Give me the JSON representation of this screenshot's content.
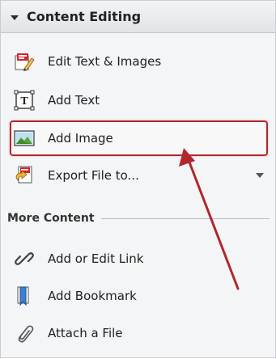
{
  "header": {
    "title": "Content Editing"
  },
  "content_editing": {
    "items": [
      {
        "label": "Edit Text & Images",
        "icon": "edit-text-images-icon"
      },
      {
        "label": "Add Text",
        "icon": "add-text-icon"
      },
      {
        "label": "Add Image",
        "icon": "add-image-icon"
      },
      {
        "label": "Export File to...",
        "icon": "export-file-icon"
      }
    ]
  },
  "more_content": {
    "title": "More Content",
    "items": [
      {
        "label": "Add or Edit Link",
        "icon": "link-icon"
      },
      {
        "label": "Add Bookmark",
        "icon": "bookmark-icon"
      },
      {
        "label": "Attach a File",
        "icon": "paperclip-icon"
      }
    ]
  },
  "colors": {
    "highlight_border": "#b0272e",
    "arrow": "#b0272e"
  }
}
